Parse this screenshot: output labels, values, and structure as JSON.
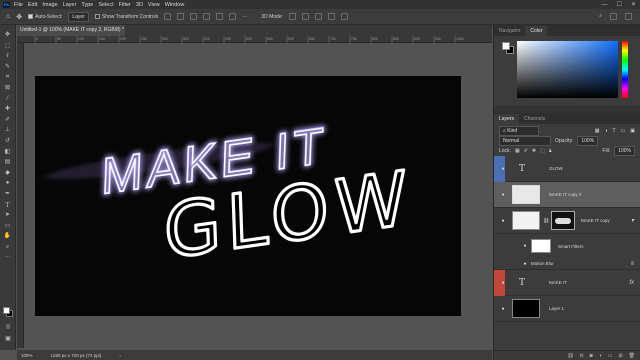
{
  "app": {
    "logo": "Ps"
  },
  "menu": [
    "File",
    "Edit",
    "Image",
    "Layer",
    "Type",
    "Select",
    "Filter",
    "3D",
    "View",
    "Window"
  ],
  "window_controls": [
    "—",
    "☐",
    "✕"
  ],
  "options": {
    "auto_select_label": "Auto-Select:",
    "auto_select_value": "Layer",
    "transform_label": "Show Transform Controls",
    "mode_3d_label": "3D Mode:"
  },
  "document": {
    "tab_title": "Untitled-1 @ 100% (MAKE IT copy 2, RGB/8) *",
    "canvas_text_line1": "MAKE IT",
    "canvas_text_line2": "GLOW",
    "glow_color": "#b8a8ff"
  },
  "ruler_labels": [
    "0",
    "50",
    "100",
    "150",
    "200",
    "250",
    "300",
    "350",
    "400",
    "450",
    "500",
    "550",
    "600",
    "650",
    "700",
    "750",
    "800",
    "850",
    "900",
    "950",
    "1000"
  ],
  "status": {
    "zoom": "100%",
    "size": "1280 px x 720 px (72 ppi)"
  },
  "panels": {
    "top_tabs": [
      "Navigator",
      "Color"
    ],
    "top_active": "Color",
    "layer_tabs": [
      "Layers",
      "Channels"
    ],
    "layer_active": "Layers",
    "filter_kind": "Kind",
    "blend_mode": "Normal",
    "opacity_label": "Opacity:",
    "opacity_value": "100%",
    "lock_label": "Lock:",
    "fill_label": "Fill:",
    "fill_value": "100%"
  },
  "layers": {
    "l1_name": "GLOW",
    "l1_color": "#4a6fb5",
    "l2_name": "MAKE IT copy 2",
    "l3_name": "MAKE IT copy",
    "l3_sub1": "Smart Filters",
    "l3_sub2": "Motion Blur",
    "l4_name": "MAKE IT",
    "l4_color": "#c0473a",
    "l4_fx": "fx",
    "l5_name": "Layer 1"
  },
  "footer_icons": [
    "link-icon",
    "fx-icon",
    "mask-icon",
    "adjustment-icon",
    "folder-icon",
    "new-layer-icon",
    "trash-icon"
  ]
}
